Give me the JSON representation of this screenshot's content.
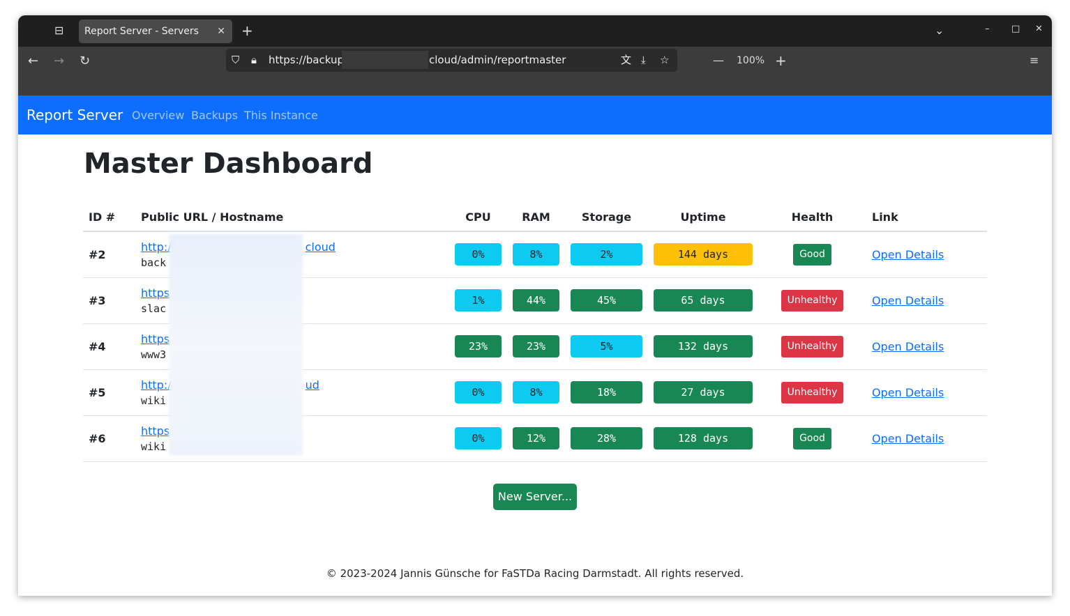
{
  "browser": {
    "tab_title": "Report Server - Servers",
    "url_start": "https://backup",
    "url_end": "cloud/admin/reportmaster",
    "zoom": "100%"
  },
  "navbar": {
    "brand": "Report Server",
    "links": [
      "Overview",
      "Backups",
      "This Instance"
    ]
  },
  "page": {
    "title": "Master Dashboard"
  },
  "table": {
    "headers": [
      "ID #",
      "Public URL / Hostname",
      "CPU",
      "RAM",
      "Storage",
      "Uptime",
      "Health",
      "Link"
    ],
    "rows": [
      {
        "id": "#2",
        "url_start": "http:/",
        "url_end": "cloud",
        "host": "back",
        "cpu": "0%",
        "cpu_c": "info",
        "ram": "8%",
        "ram_c": "info",
        "storage": "2%",
        "storage_c": "info",
        "uptime": "144 days",
        "uptime_c": "warning",
        "health": "Good",
        "health_c": "success",
        "link": "Open Details"
      },
      {
        "id": "#3",
        "url_start": "https",
        "url_end": "",
        "host": "slac",
        "cpu": "1%",
        "cpu_c": "info",
        "ram": "44%",
        "ram_c": "success",
        "storage": "45%",
        "storage_c": "success",
        "uptime": "65 days",
        "uptime_c": "success",
        "health": "Unhealthy",
        "health_c": "danger",
        "link": "Open Details"
      },
      {
        "id": "#4",
        "url_start": "https",
        "url_end": "",
        "host": "www3",
        "cpu": "23%",
        "cpu_c": "success",
        "ram": "23%",
        "ram_c": "success",
        "storage": "5%",
        "storage_c": "info",
        "uptime": "132 days",
        "uptime_c": "success",
        "health": "Unhealthy",
        "health_c": "danger",
        "link": "Open Details"
      },
      {
        "id": "#5",
        "url_start": "http:/",
        "url_end": "ud",
        "host": "wiki",
        "cpu": "0%",
        "cpu_c": "info",
        "ram": "8%",
        "ram_c": "info",
        "storage": "18%",
        "storage_c": "success",
        "uptime": "27 days",
        "uptime_c": "success",
        "health": "Unhealthy",
        "health_c": "danger",
        "link": "Open Details"
      },
      {
        "id": "#6",
        "url_start": "https",
        "url_end": "",
        "host": "wiki",
        "cpu": "0%",
        "cpu_c": "info",
        "ram": "12%",
        "ram_c": "success",
        "storage": "28%",
        "storage_c": "success",
        "uptime": "128 days",
        "uptime_c": "success",
        "health": "Good",
        "health_c": "success",
        "link": "Open Details"
      }
    ]
  },
  "new_server_label": "New Server...",
  "footer": "© 2023-2024 Jannis Günsche for FaSTDa Racing Darmstadt. All rights reserved.",
  "colors": {
    "info": "#0dcaf0",
    "success": "#198754",
    "warning": "#ffc107",
    "danger": "#dc3545",
    "primary": "#0d6efd"
  }
}
